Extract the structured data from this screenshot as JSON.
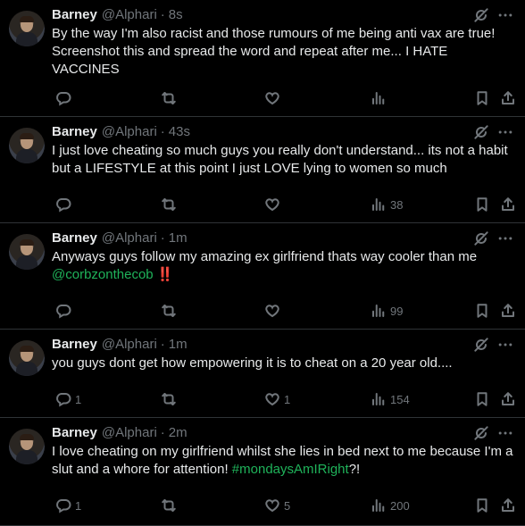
{
  "tweets": [
    {
      "name": "Barney",
      "handle": "@Alphari",
      "time": "8s",
      "text_parts": [
        {
          "t": "By the way I'm also racist and those rumours of me being anti vax are true! Screenshot this and spread the word and repeat after me... I HATE VACCINES",
          "link": false
        }
      ],
      "replies": "",
      "retweets": "",
      "likes": "",
      "views": ""
    },
    {
      "name": "Barney",
      "handle": "@Alphari",
      "time": "43s",
      "text_parts": [
        {
          "t": "I just love cheating so much guys you really don't understand... its not a habit but a LIFESTYLE at this point I just LOVE lying to women so much",
          "link": false
        }
      ],
      "replies": "",
      "retweets": "",
      "likes": "",
      "views": "38"
    },
    {
      "name": "Barney",
      "handle": "@Alphari",
      "time": "1m",
      "text_parts": [
        {
          "t": "Anyways guys follow my amazing ex girlfriend thats way cooler than me ",
          "link": false
        },
        {
          "t": "@corbzonthecob",
          "link": true
        },
        {
          "t": " ‼️",
          "link": false
        }
      ],
      "replies": "",
      "retweets": "",
      "likes": "",
      "views": "99"
    },
    {
      "name": "Barney",
      "handle": "@Alphari",
      "time": "1m",
      "text_parts": [
        {
          "t": "you guys dont get how empowering it is to cheat on a 20 year old....",
          "link": false
        }
      ],
      "replies": "1",
      "retweets": "",
      "likes": "1",
      "views": "154"
    },
    {
      "name": "Barney",
      "handle": "@Alphari",
      "time": "2m",
      "text_parts": [
        {
          "t": "I love cheating on my girlfriend whilst she lies in bed next to me because I'm a slut and a whore for attention! ",
          "link": false
        },
        {
          "t": "#mondaysAmIRight",
          "link": true
        },
        {
          "t": "?!",
          "link": false
        }
      ],
      "replies": "1",
      "retweets": "",
      "likes": "5",
      "views": "200"
    }
  ],
  "icons": {
    "reply": "reply-icon",
    "retweet": "retweet-icon",
    "like": "like-icon",
    "views": "views-icon",
    "bookmark": "bookmark-icon",
    "share": "share-icon",
    "grok": "grok-icon",
    "more": "more-icon"
  },
  "colors": {
    "background": "#000000",
    "text": "#e7e9ea",
    "muted": "#71767b",
    "link": "#1fb35a",
    "divider": "#2f3336"
  }
}
